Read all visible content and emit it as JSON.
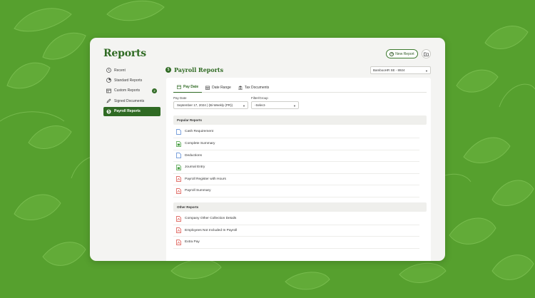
{
  "page": {
    "title": "Reports",
    "new_report_label": "New Report"
  },
  "sidebar": {
    "items": [
      {
        "label": "Recent",
        "icon": "clock-icon"
      },
      {
        "label": "Standard Reports",
        "icon": "pie-chart-icon"
      },
      {
        "label": "Custom Reports",
        "icon": "table-icon",
        "badge": "2"
      },
      {
        "label": "Signed Documents",
        "icon": "pen-icon"
      },
      {
        "label": "Payroll Reports",
        "icon": "dollar-icon",
        "active": true
      }
    ]
  },
  "section": {
    "title": "Payroll Reports",
    "company_select": "BambooHR SE - 8924"
  },
  "tabs": [
    {
      "label": "Pay Date",
      "icon": "calendar-icon",
      "active": true
    },
    {
      "label": "Date Range",
      "icon": "calendar-grid-icon"
    },
    {
      "label": "Tax Documents",
      "icon": "bank-icon"
    }
  ],
  "filters": {
    "pay_date_label": "Pay Date",
    "pay_date_value": "September 17, 2024 | (Bi-Weekly (PR))",
    "filter_group_label": "Filter/Group",
    "filter_group_value": "-Select-"
  },
  "popular_reports": {
    "header": "Popular Reports",
    "items": [
      {
        "label": "Cash Requirement",
        "type": "doc"
      },
      {
        "label": "Complete Summary",
        "type": "sheet"
      },
      {
        "label": "Deductions",
        "type": "doc"
      },
      {
        "label": "Journal Entry",
        "type": "sheet"
      },
      {
        "label": "Payroll Register with Hours",
        "type": "pdf"
      },
      {
        "label": "Payroll Summary",
        "type": "pdf"
      }
    ]
  },
  "other_reports": {
    "header": "Other Reports",
    "items": [
      {
        "label": "Company Other Collection Details",
        "type": "pdf"
      },
      {
        "label": "Employees Not Included In Payroll",
        "type": "pdf"
      },
      {
        "label": "Extra Pay",
        "type": "pdf"
      }
    ]
  },
  "colors": {
    "background": "#56a02e",
    "brand": "#2f6a23",
    "doc": "#4a7fcf",
    "sheet": "#3f9a3a",
    "pdf": "#d8423a"
  }
}
